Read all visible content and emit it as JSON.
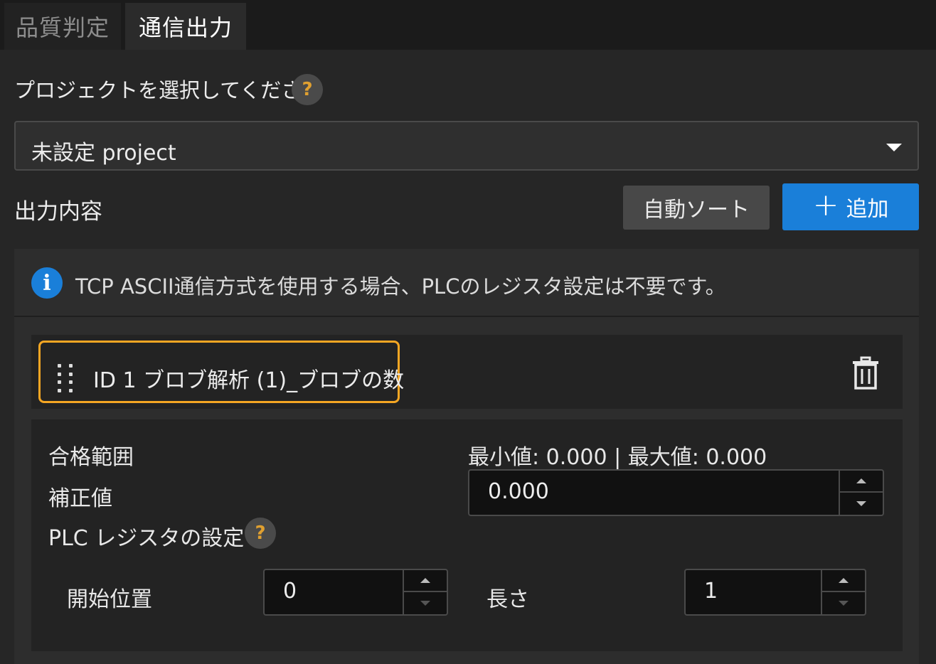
{
  "tabs": [
    {
      "label": "品質判定",
      "active": false
    },
    {
      "label": "通信出力",
      "active": true
    }
  ],
  "project": {
    "label": "プロジェクトを選択してください",
    "help": "?",
    "selected": "未設定 project"
  },
  "output": {
    "title": "出力内容",
    "auto_sort_label": "自動ソート",
    "add_label": "追加",
    "info_text": "TCP ASCII通信方式を使用する場合、PLCのレジスタ設定は不要です。",
    "item": {
      "title": "ID 1  ブロブ解析 (1)_ブロブの数",
      "pass_range_label": "合格範囲",
      "range_text": "最小値: 0.000 | 最大値: 0.000",
      "offset_label": "補正値",
      "offset_value": "0.000",
      "plc_label": "PLC レジスタの設定",
      "plc_help": "?",
      "start_label": "開始位置",
      "start_value": "0",
      "length_label": "長さ",
      "length_value": "1"
    }
  },
  "colors": {
    "accent": "#1a7fd9",
    "highlight": "#f5a623",
    "help": "#e0a030"
  }
}
